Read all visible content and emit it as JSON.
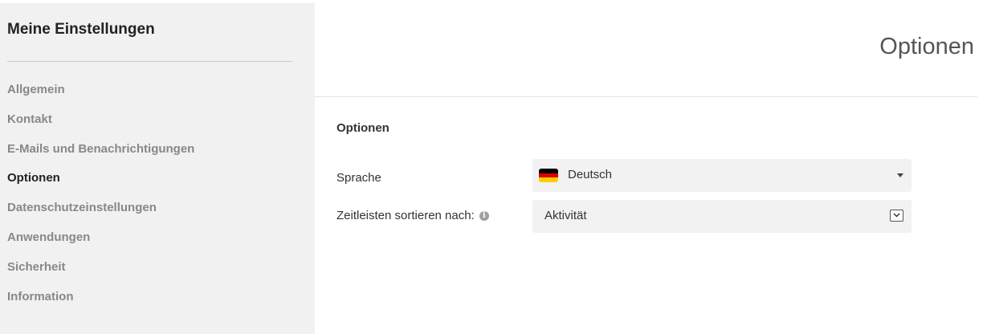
{
  "sidebar": {
    "title": "Meine Einstellungen",
    "items": [
      {
        "label": "Allgemein",
        "active": false
      },
      {
        "label": "Kontakt",
        "active": false
      },
      {
        "label": "E-Mails und Benachrichtigungen",
        "active": false
      },
      {
        "label": "Optionen",
        "active": true
      },
      {
        "label": "Datenschutzeinstellungen",
        "active": false
      },
      {
        "label": "Anwendungen",
        "active": false
      },
      {
        "label": "Sicherheit",
        "active": false
      },
      {
        "label": "Information",
        "active": false
      }
    ]
  },
  "header": {
    "title": "Optionen"
  },
  "options": {
    "section_title": "Optionen",
    "language": {
      "label": "Sprache",
      "value": "Deutsch",
      "icon": "germany-flag-icon"
    },
    "timeline_sort": {
      "label": "Zeitleisten sortieren nach:",
      "info_icon": "info-icon",
      "value": "Aktivität"
    }
  },
  "colors": {
    "sidebar_bg": "#f1f1f1",
    "select_bg": "#f2f2f2",
    "active_text": "#222222",
    "inactive_text": "#888888"
  }
}
